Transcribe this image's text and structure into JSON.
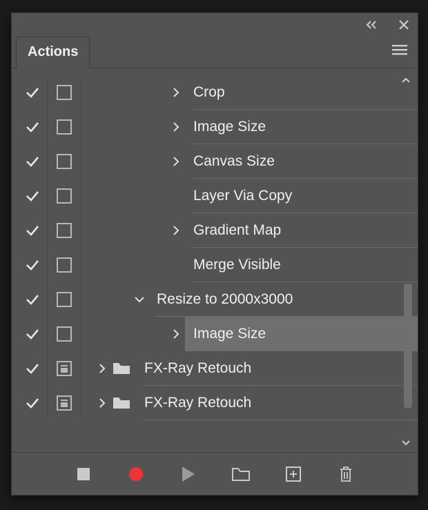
{
  "panel": {
    "tab_label": "Actions"
  },
  "rows": [
    {
      "checked": true,
      "dialog": "empty",
      "indent": 125,
      "expand": "right",
      "folder": false,
      "label": "Crop",
      "selected": false
    },
    {
      "checked": true,
      "dialog": "empty",
      "indent": 125,
      "expand": "right",
      "folder": false,
      "label": "Image Size",
      "selected": false
    },
    {
      "checked": true,
      "dialog": "empty",
      "indent": 125,
      "expand": "right",
      "folder": false,
      "label": "Canvas Size",
      "selected": false
    },
    {
      "checked": true,
      "dialog": "empty",
      "indent": 125,
      "expand": "none",
      "folder": false,
      "label": "Layer Via Copy",
      "selected": false
    },
    {
      "checked": true,
      "dialog": "empty",
      "indent": 125,
      "expand": "right",
      "folder": false,
      "label": "Gradient Map",
      "selected": false
    },
    {
      "checked": true,
      "dialog": "empty",
      "indent": 125,
      "expand": "none",
      "folder": false,
      "label": "Merge Visible",
      "selected": false
    },
    {
      "checked": true,
      "dialog": "empty",
      "indent": 72,
      "expand": "down",
      "folder": false,
      "label": "Resize to 2000x3000",
      "selected": false
    },
    {
      "checked": true,
      "dialog": "empty",
      "indent": 125,
      "expand": "right",
      "folder": false,
      "label": "Image Size",
      "selected": true
    },
    {
      "checked": true,
      "dialog": "filled",
      "indent": 18,
      "expand": "right",
      "folder": true,
      "label": "FX-Ray Retouch",
      "selected": false
    },
    {
      "checked": true,
      "dialog": "filled",
      "indent": 18,
      "expand": "right",
      "folder": true,
      "label": "FX-Ray Retouch",
      "selected": false
    }
  ],
  "footer": {
    "stop": "Stop",
    "record": "Record",
    "play": "Play",
    "newset": "New Set",
    "newact": "New Action",
    "trash": "Delete"
  }
}
